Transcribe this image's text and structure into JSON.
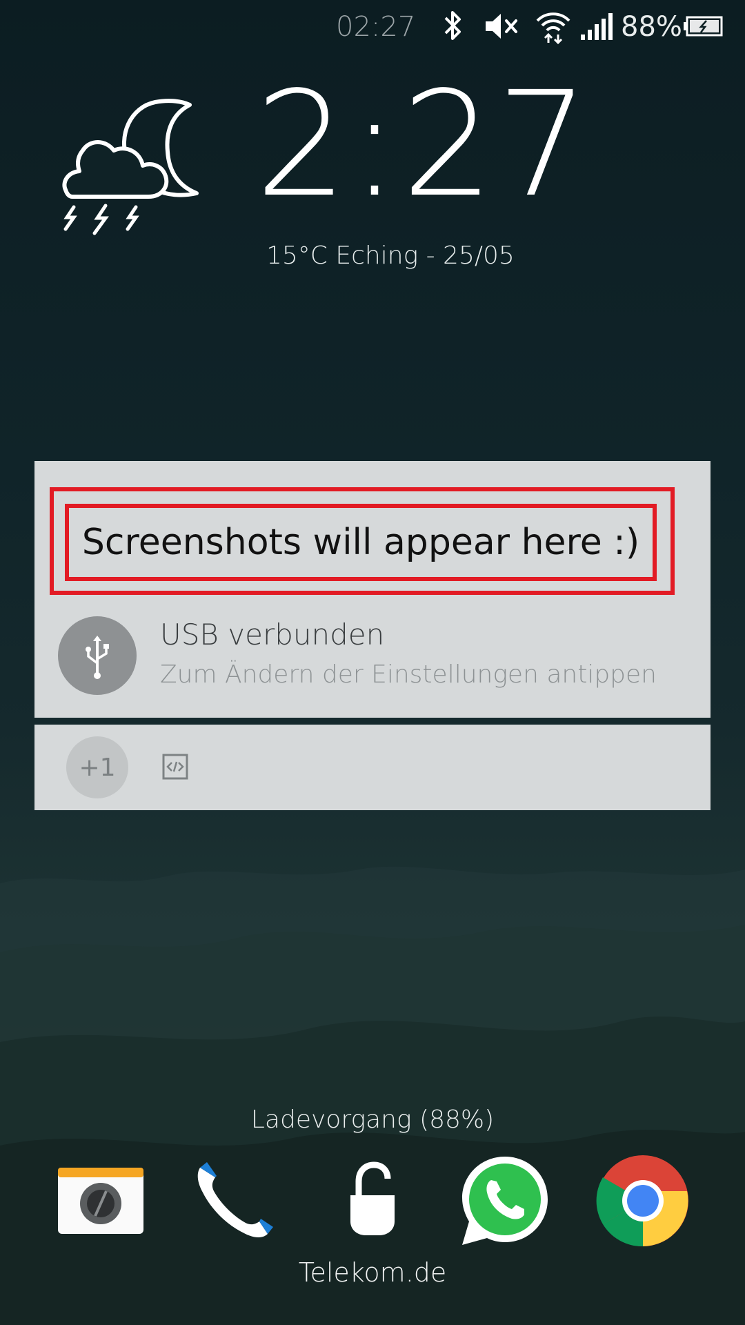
{
  "status_bar": {
    "time": "02:27",
    "battery_percent": "88%",
    "icons": [
      "bluetooth-icon",
      "mute-icon",
      "wifi-icon",
      "signal-icon",
      "battery-charging-icon"
    ]
  },
  "lockscreen": {
    "clock": "2:27",
    "weather_line": "15°C Eching - 25/05",
    "weather_icon": "night-thunderstorm-icon"
  },
  "notifications": {
    "placeholder_text": "Screenshots will appear here :)",
    "usb": {
      "title": "USB verbunden",
      "subtitle": "Zum Ändern der Einstellungen antippen",
      "icon": "usb-icon"
    },
    "overflow": {
      "count_label": "+1",
      "icon": "developer-code-icon"
    }
  },
  "bottom": {
    "charging_text": "Ladevorgang (88%)",
    "carrier": "Telekom.de",
    "dock": [
      "camera-icon",
      "phone-icon",
      "unlock-icon",
      "whatsapp-icon",
      "chrome-icon"
    ]
  },
  "colors": {
    "highlight_frame": "#e21b24",
    "card_bg": "#d6d9da"
  }
}
